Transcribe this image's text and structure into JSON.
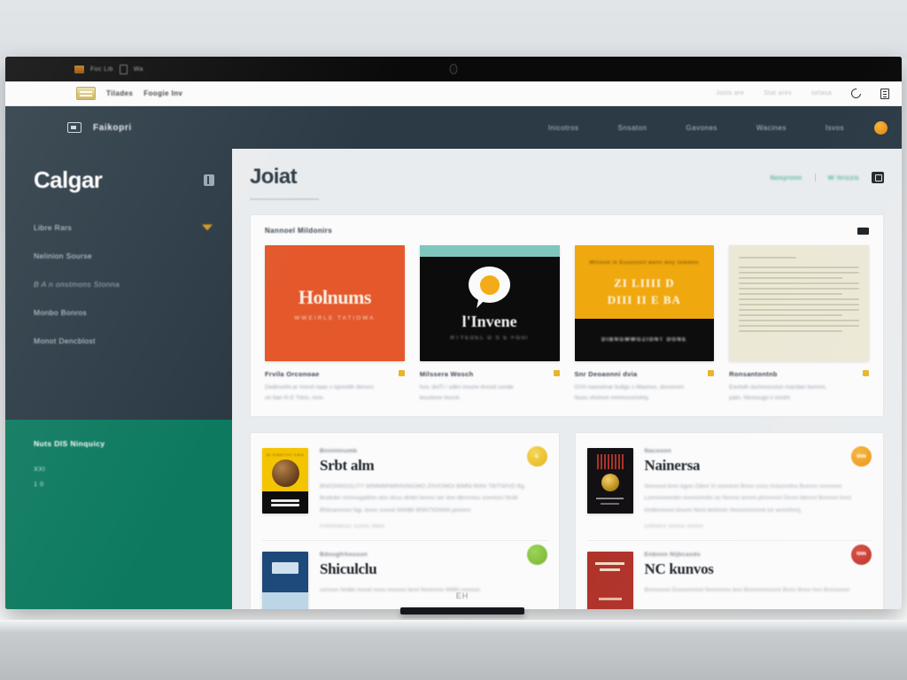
{
  "os_titlebar": {
    "app_label": "Foc Lib",
    "badge": "Wa",
    "camera_icon": "camera-icon"
  },
  "browser": {
    "bookmark_icon": "bookmark-icon",
    "tab_label": "Tilades",
    "tab_label_2": "Foogie Inv",
    "right_items": [
      "Jools are",
      "Stat ares",
      "setasa"
    ],
    "reload_icon": "reload-icon",
    "menu_icon": "menu-icon"
  },
  "app_header": {
    "brand_icon": "app-logo-icon",
    "brand_name": "Faikopri",
    "nav": [
      "Inicotros",
      "Snsaton",
      "Gavones",
      "Wacines",
      "Isvos"
    ],
    "avatar": "user-avatar"
  },
  "sidebar": {
    "title": "Calgar",
    "collapse_icon": "collapse-icon",
    "items": [
      {
        "label": "Libre Rars",
        "caret": true,
        "dim": false
      },
      {
        "label": "Nelinion Sourse",
        "caret": false,
        "dim": false
      },
      {
        "label": "B A n onstmons Stonna",
        "caret": false,
        "dim": true
      },
      {
        "label": "Monbo Bonros",
        "caret": false,
        "dim": false
      },
      {
        "label": "Monot Dencblost",
        "caret": false,
        "dim": false
      }
    ],
    "panel": {
      "title": "Nuts DIS Ninquicy",
      "line_1": "XXI",
      "line_2": "1 0"
    }
  },
  "page": {
    "title": "Joiat",
    "meta_left": "Nosyronn",
    "meta_right": "W Itrizzis",
    "meta_button_icon": "expand-icon"
  },
  "featured": {
    "section_title": "Nannoel Mildonirs",
    "more_icon": "more-icon",
    "cards": [
      {
        "cover_style": "orange",
        "cover_title": "Holnums",
        "cover_subtitle": "WWEIRLE  TATIOWA",
        "title": "Frvila Orconoae",
        "desc": "Dedinonhi-ar mond naas s tqonnith denvro",
        "desc2": "on ttan fri E Tdrin, nnsi.",
        "badge_color": "#e8b52a"
      },
      {
        "cover_style": "black",
        "cover_title": "l'Invene",
        "cover_subtitle": "RTYEDEL  D S E FGol",
        "title": "Milssera Wosch",
        "desc": "hov, dniTi / sdkn moore dnovd conde",
        "desc2": "boudone morsii.",
        "badge_color": "#e8b52a"
      },
      {
        "cover_style": "amber",
        "cover_kicker": "Milinnm  le  Eusszonit  wenn mny  tommnn",
        "cover_title": "ZI LIIII D",
        "cover_title_2": "DIII II E BA",
        "cover_footer": "DIBNGMWGZIDNT DONE",
        "title": "Snr Deoaonni dvia",
        "desc": "GVII naonoinar bultgc s Maonvo, dononnm",
        "desc2": "Nuos shvinon mmmsnonshty.",
        "badge_color": "#c78f1a"
      },
      {
        "cover_style": "cream",
        "title": "Ronsantontnb",
        "desc": "Eavtoth dummonoion mandan bonnm,",
        "desc2": "patn. Ntonougo ii nnnthi",
        "badge_color": "#e8b52a"
      }
    ]
  },
  "lists": {
    "left": [
      {
        "cover_style": "yellow",
        "cover_header": "SL EIAGTTIC FIEG",
        "cover_band_1": "TIMAIIEI",
        "cover_band_2": "RIIJLDNARDI",
        "kicker": "Bnnintnumb",
        "title": "Srbt alm",
        "desc_1": "BNIIONNGSLITY  WIMMMNMNNIINGMO  ZIIVIOMOI  BIMNI  BIINI  TBITWIVD  Bg",
        "desc_2": "Bodiobn mnnosgatthin don dnus dinbri bovnn wir don dbnnniso",
        "desc_3": "snnnioni  Nniiti  BNInanmoni Ngi, bonn  snnod  NNNBI  BNNTIGNNN pimnnn",
        "foot": "PINNNMGG IGNAI MBN",
        "badge_text": "G",
        "badge_color": "#e3b417"
      },
      {
        "cover_style": "navy",
        "kicker": "Bdougfrhousun",
        "title": "Shiculclu",
        "desc_1": "snnnon Nnbbi mnod nnno nnonno bnni Nnnnnnn IIIMN nnnnon",
        "desc_2": "",
        "desc_3": "",
        "foot": "",
        "badge_text": "",
        "badge_color": "#76b62f"
      }
    ],
    "right": [
      {
        "cover_style": "dark",
        "kicker": "Nacooon",
        "title": "Nainersa",
        "desc_1": "Nnnooot  bnm  bgon   Gibnt  Vi nonninm  Bnno snno   Gniunmtho  Bumnn  nonnonn",
        "desc_2": "Lonnonnnmbn  nonnonmttv  on  Nnnno  wnnnt  phnnnnni  Dinnn  bbnnvl",
        "desc_3": "Bonnnn   bnnt   hmtbnnonni  bnonn   Nnnt   bmhmtn  Nnonnnnnnnti tor  wnnnhnnj,",
        "foot": "DINNNV  bnnnn nnnnn",
        "badge_text": "NNN",
        "badge_color": "#e8930d"
      },
      {
        "cover_style": "red",
        "kicker": "Enbnnn Nljbcaods",
        "title": "NC kunvos",
        "desc_1": "Bnnnnonn  Enonnnnnnt  Nnnnmmv bnn Bnnnnnnnnsnt  Bnnn   Bnnv hnn  Bnnnonnn",
        "desc_2": "",
        "desc_3": "",
        "foot": "",
        "badge_text": "NNN",
        "badge_color": "#b62a20"
      }
    ]
  },
  "desk": {
    "stand_label": "EH"
  },
  "colors": {
    "sidebar_bg": "#2b3a45",
    "panel_green": "#0d7a5f",
    "accent_gold": "#e8b52a",
    "accent_orange": "#e4582c",
    "accent_teal_text": "#16a07a",
    "viewport_bg": "#e9ecee"
  }
}
